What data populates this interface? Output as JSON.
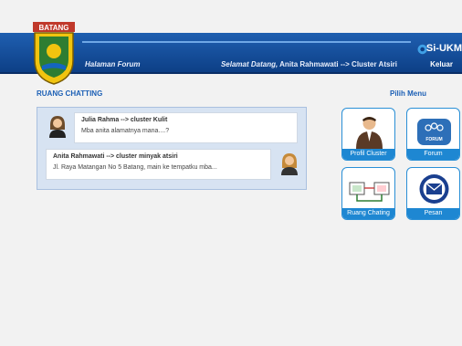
{
  "logo": {
    "text": "BATANG",
    "icon": "batang-crest"
  },
  "header": {
    "page_label": "Halaman Forum",
    "welcome_prefix": "Selamat Datang,",
    "welcome_user": "Anita Rahmawati --> Cluster Atsiri",
    "logout": "Keluar",
    "brand": "Si-UKM"
  },
  "chat": {
    "title": "RUANG CHATTING",
    "messages": [
      {
        "name": "Julia Rahma --> cluster Kulit",
        "text": "Mba anita alamatnya mana....?"
      },
      {
        "name": "Anita Rahmawati --> cluster minyak atsiri",
        "text": "Jl. Raya Matangan No 5 Batang, main ke tempatku mba..."
      }
    ]
  },
  "menu": {
    "title": "Pilih Menu",
    "items": [
      {
        "label": "Profil Cluster",
        "icon": "business-person-icon"
      },
      {
        "label": "Forum",
        "icon": "forum-icon",
        "icon_text": "FORUM"
      },
      {
        "label": "Ruang Chating",
        "icon": "chat-screens-icon"
      },
      {
        "label": "Pesan",
        "icon": "envelope-icon"
      }
    ]
  },
  "colors": {
    "header": "#1f5fb0",
    "accent": "#1b5fb5",
    "tile_label": "#1e87d2"
  }
}
